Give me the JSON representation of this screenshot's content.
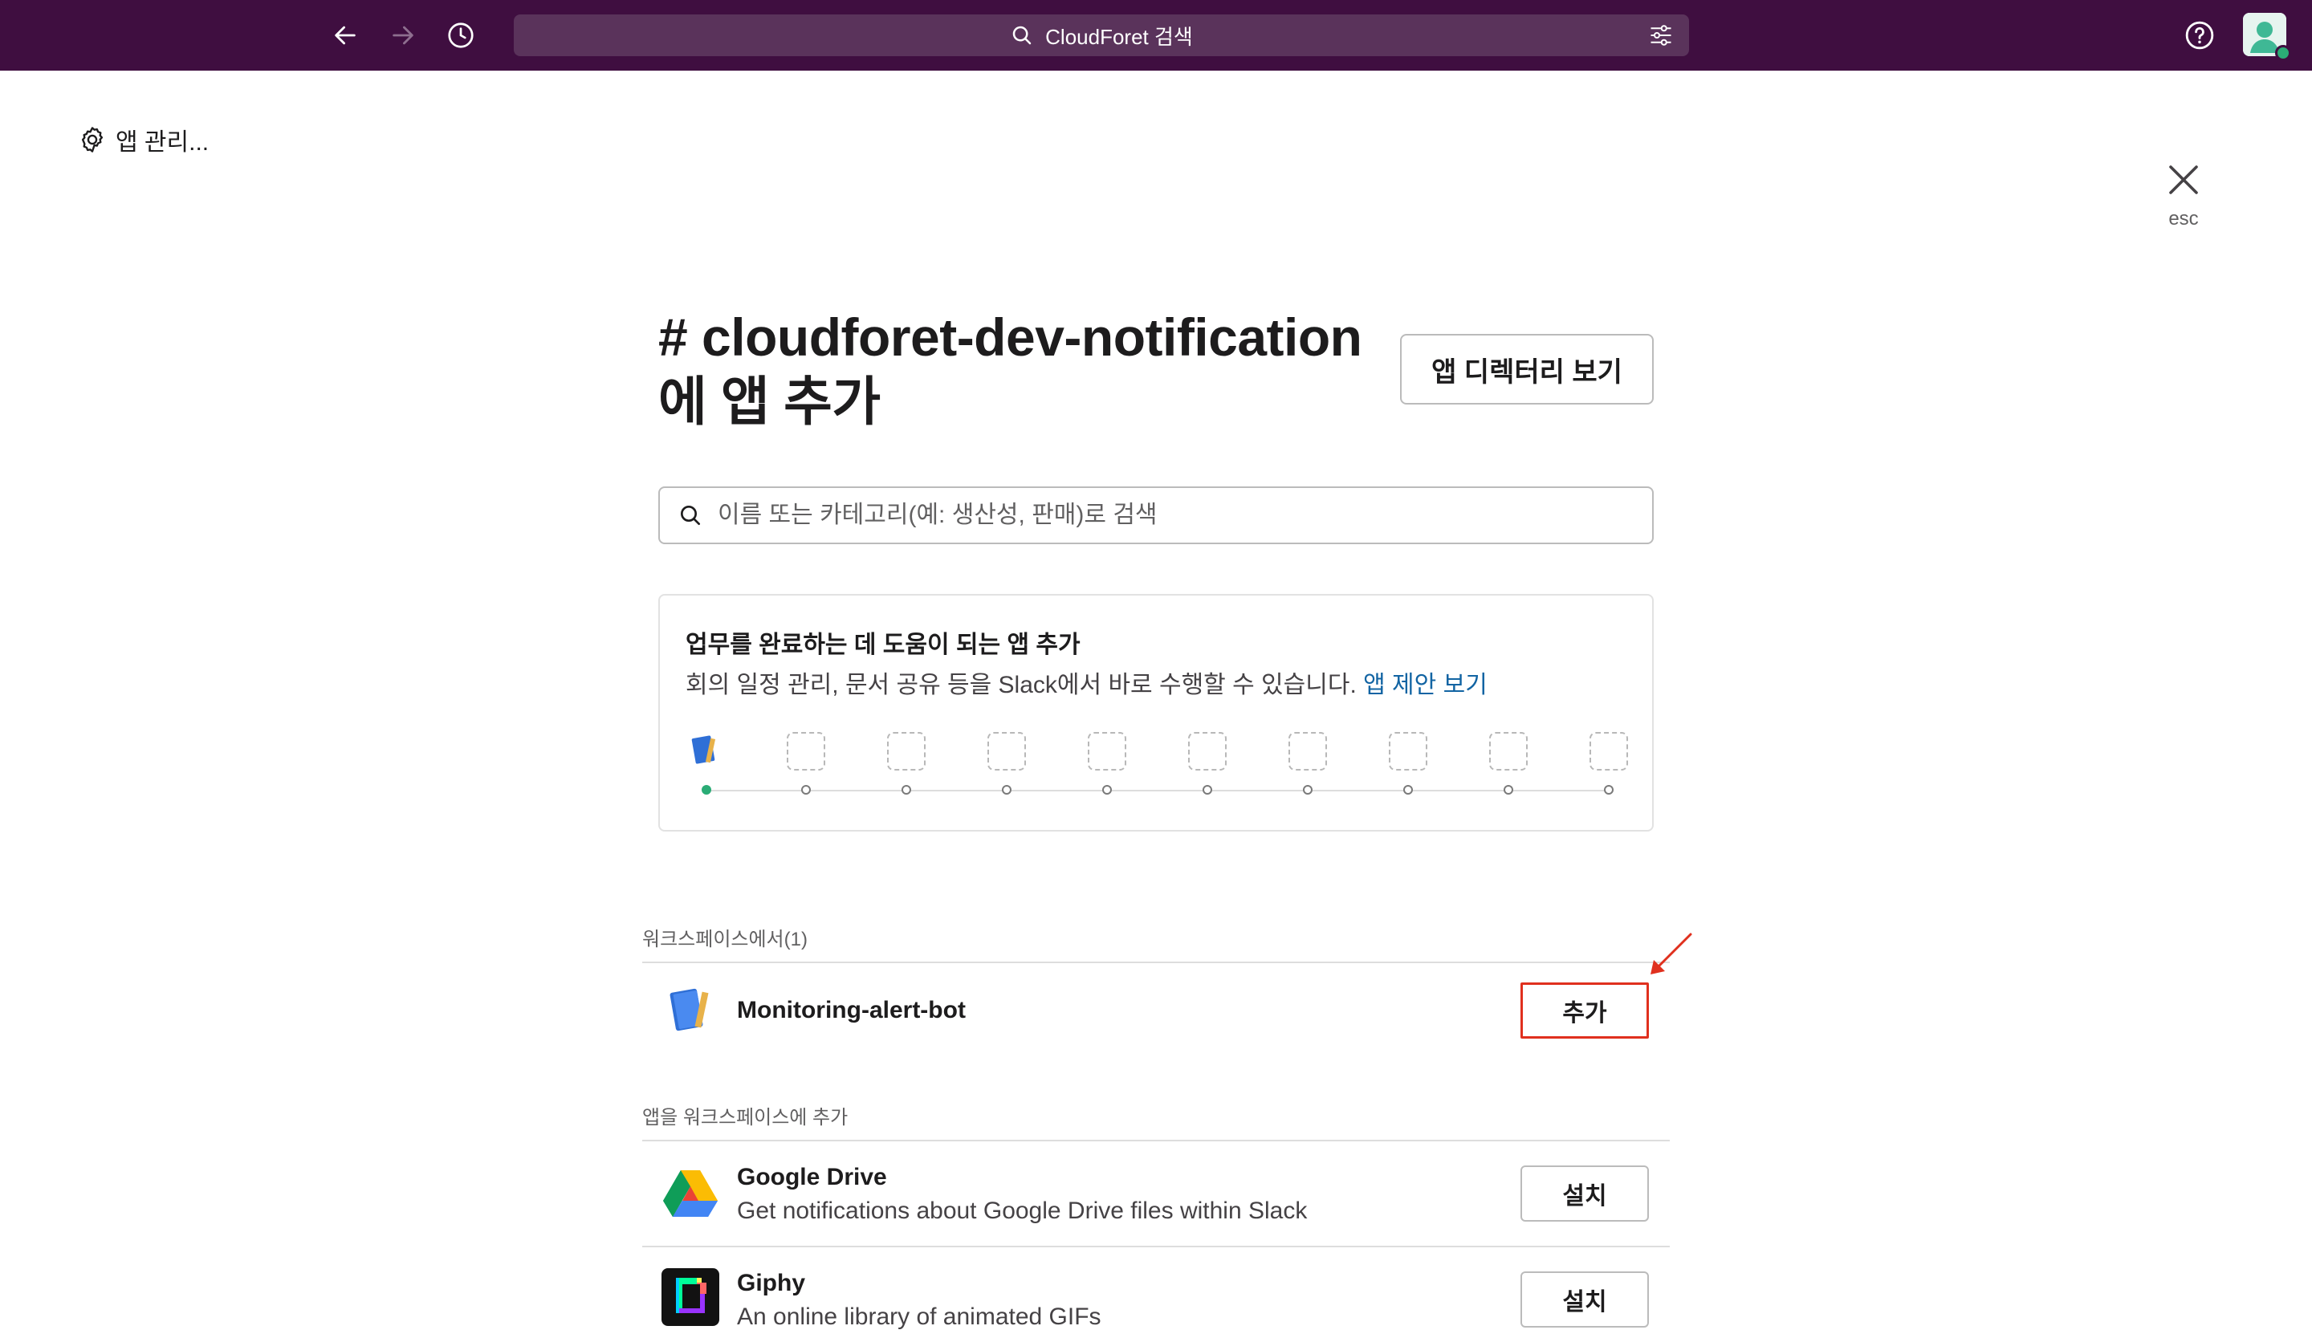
{
  "topbar": {
    "search_label": "CloudForet 검색"
  },
  "manage": {
    "label": "앱 관리..."
  },
  "close": {
    "esc_label": "esc"
  },
  "header": {
    "title": "# cloudforet-dev-notification 에 앱 추가",
    "directory_button": "앱 디렉터리 보기"
  },
  "app_search": {
    "placeholder": "이름 또는 카테고리(예: 생산성, 판매)로 검색"
  },
  "suggestion": {
    "title": "업무를 완료하는 데 도움이 되는 앱 추가",
    "desc": "회의 일정 관리, 문서 공유 등을 Slack에서 바로 수행할 수 있습니다.",
    "link": "앱 제안 보기"
  },
  "workspace_section": {
    "label": "워크스페이스에서(1)",
    "apps": [
      {
        "name": "Monitoring-alert-bot",
        "action": "추가",
        "icon": "notebook-icon"
      }
    ]
  },
  "add_section": {
    "label": "앱을 워크스페이스에 추가",
    "apps": [
      {
        "name": "Google Drive",
        "desc": "Get notifications about Google Drive files within Slack",
        "action": "설치",
        "icon": "google-drive-icon"
      },
      {
        "name": "Giphy",
        "desc": "An online library of animated GIFs",
        "action": "설치",
        "icon": "giphy-icon"
      }
    ]
  },
  "colors": {
    "topbar": "#3f0e40",
    "link": "#1264a3",
    "highlight": "#e0301e",
    "active_dot": "#2bac76"
  }
}
